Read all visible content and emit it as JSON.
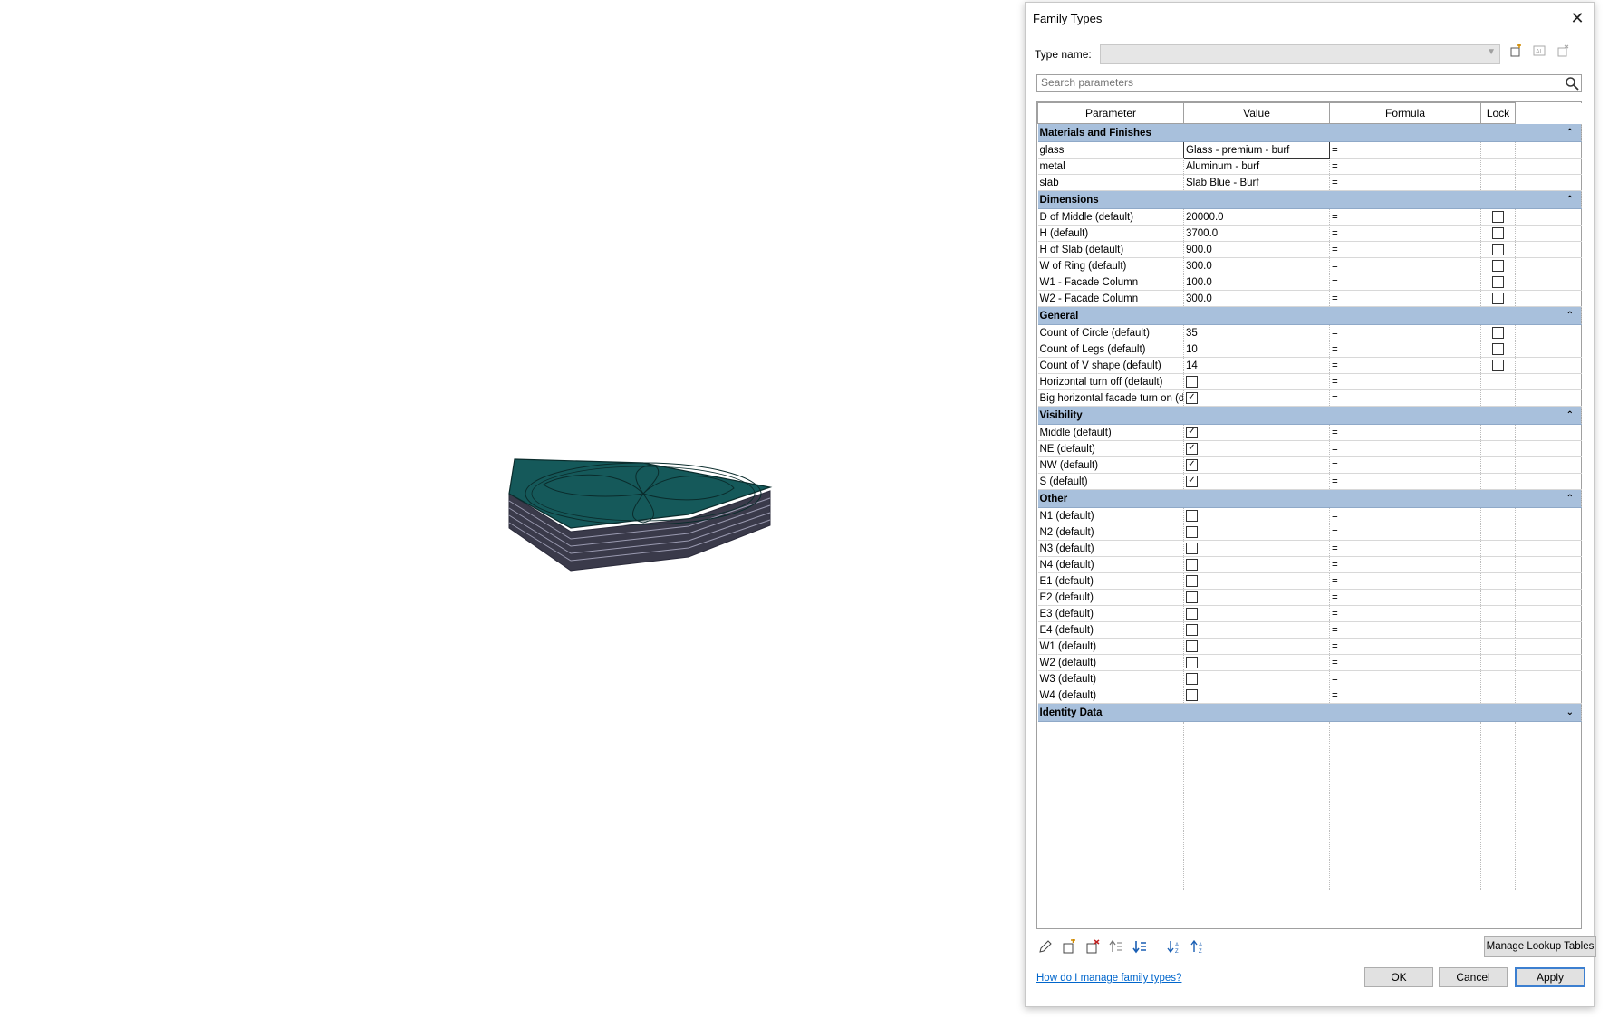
{
  "dialog": {
    "title": "Family Types",
    "close_icon": "close-icon",
    "type_name_label": "Type name:",
    "type_name_value": "",
    "search_placeholder": "Search parameters",
    "columns": [
      "Parameter",
      "Value",
      "Formula",
      "Lock"
    ],
    "groups": [
      {
        "name": "Materials and Finishes",
        "collapsed": false,
        "rows": [
          {
            "param": "glass",
            "value": "Glass - premium - burf",
            "formula": "=",
            "lock": null
          },
          {
            "param": "metal",
            "value": "Aluminum - burf",
            "formula": "=",
            "lock": null
          },
          {
            "param": "slab",
            "value": "Slab Blue - Burf",
            "formula": "=",
            "lock": null
          }
        ]
      },
      {
        "name": "Dimensions",
        "collapsed": false,
        "rows": [
          {
            "param": "D of Middle (default)",
            "value": "20000.0",
            "formula": "=",
            "lock": false
          },
          {
            "param": "H (default)",
            "value": "3700.0",
            "formula": "=",
            "lock": false
          },
          {
            "param": "H of Slab (default)",
            "value": "900.0",
            "formula": "=",
            "lock": false
          },
          {
            "param": "W of Ring (default)",
            "value": "300.0",
            "formula": "=",
            "lock": false
          },
          {
            "param": "W1 - Facade Column",
            "value": "100.0",
            "formula": "=",
            "lock": false
          },
          {
            "param": "W2 - Facade Column",
            "value": "300.0",
            "formula": "=",
            "lock": false
          }
        ]
      },
      {
        "name": "General",
        "collapsed": false,
        "rows": [
          {
            "param": "Count of Circle (default)",
            "value": "35",
            "formula": "=",
            "lock": false
          },
          {
            "param": "Count of Legs (default)",
            "value": "10",
            "formula": "=",
            "lock": false
          },
          {
            "param": "Count of V shape (default)",
            "value": "14",
            "formula": "=",
            "lock": false
          },
          {
            "param": "Horizontal turn off (default)",
            "checkbox": false,
            "formula": "=",
            "lock": null
          },
          {
            "param": "Big horizontal facade turn on (def",
            "checkbox": true,
            "formula": "=",
            "lock": null
          }
        ]
      },
      {
        "name": "Visibility",
        "collapsed": false,
        "rows": [
          {
            "param": "Middle (default)",
            "checkbox": true,
            "formula": "=",
            "lock": null
          },
          {
            "param": "NE (default)",
            "checkbox": true,
            "formula": "=",
            "lock": null
          },
          {
            "param": "NW (default)",
            "checkbox": true,
            "formula": "=",
            "lock": null
          },
          {
            "param": "S (default)",
            "checkbox": true,
            "formula": "=",
            "lock": null
          }
        ]
      },
      {
        "name": "Other",
        "collapsed": false,
        "rows": [
          {
            "param": "N1 (default)",
            "checkbox": false,
            "formula": "=",
            "lock": null
          },
          {
            "param": "N2 (default)",
            "checkbox": false,
            "formula": "=",
            "lock": null
          },
          {
            "param": "N3 (default)",
            "checkbox": false,
            "formula": "=",
            "lock": null
          },
          {
            "param": "N4 (default)",
            "checkbox": false,
            "formula": "=",
            "lock": null
          },
          {
            "param": "E1 (default)",
            "checkbox": false,
            "formula": "=",
            "lock": null
          },
          {
            "param": "E2 (default)",
            "checkbox": false,
            "formula": "=",
            "lock": null
          },
          {
            "param": "E3 (default)",
            "checkbox": false,
            "formula": "=",
            "lock": null
          },
          {
            "param": "E4 (default)",
            "checkbox": false,
            "formula": "=",
            "lock": null
          },
          {
            "param": "W1 (default)",
            "checkbox": false,
            "formula": "=",
            "lock": null
          },
          {
            "param": "W2 (default)",
            "checkbox": false,
            "formula": "=",
            "lock": null
          },
          {
            "param": "W3 (default)",
            "checkbox": false,
            "formula": "=",
            "lock": null
          },
          {
            "param": "W4 (default)",
            "checkbox": false,
            "formula": "=",
            "lock": null
          }
        ]
      },
      {
        "name": "Identity Data",
        "collapsed": true,
        "rows": []
      }
    ],
    "toolbar_icons": [
      "pencil-edit-icon",
      "new-parameter-icon",
      "delete-parameter-icon",
      "move-up-icon",
      "move-down-icon",
      "sort-ascending-icon",
      "sort-descending-icon"
    ],
    "manage_lookup_label": "Manage Lookup Tables",
    "help_link": "How do I manage family types?",
    "ok_label": "OK",
    "cancel_label": "Cancel",
    "apply_label": "Apply"
  },
  "colors": {
    "group_header": "#a8c0dc",
    "model_top": "#15595a",
    "accent": "#3c7fd0",
    "link": "#0066cc"
  }
}
